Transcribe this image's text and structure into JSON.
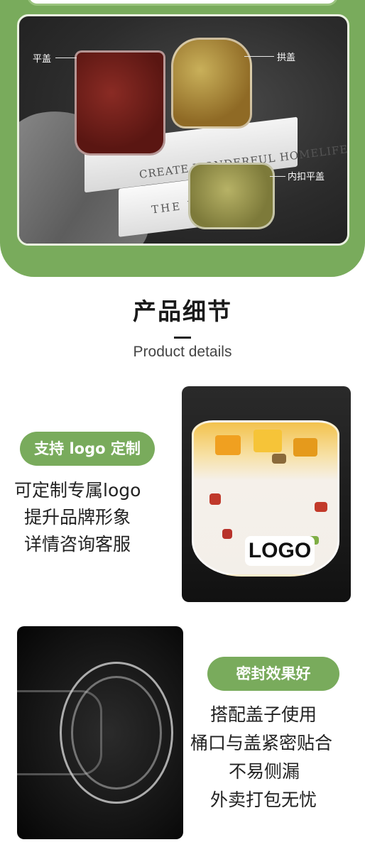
{
  "hero": {
    "labels": {
      "flat_lid": "平盖",
      "dome_lid": "拱盖",
      "inner_flat_lid": "内扣平盖"
    },
    "book_texts": [
      "CREATE WONDERFUL HOMELIFE",
      "THE KIN"
    ]
  },
  "section": {
    "title": "产品细节",
    "subtitle": "Product details"
  },
  "feature_logo": {
    "badge": "支持 logo 定制",
    "lines": [
      "可定制专属logo",
      "提升品牌形象",
      "详情咨询客服"
    ],
    "photo_tag": "LOGO"
  },
  "feature_seal": {
    "badge": "密封效果好",
    "lines": [
      "搭配盖子使用",
      "桶口与盖紧密贴合",
      "不易侧漏",
      "外卖打包无忧"
    ]
  },
  "colors": {
    "accent_green": "#79ab5c",
    "text_dark": "#222222"
  }
}
